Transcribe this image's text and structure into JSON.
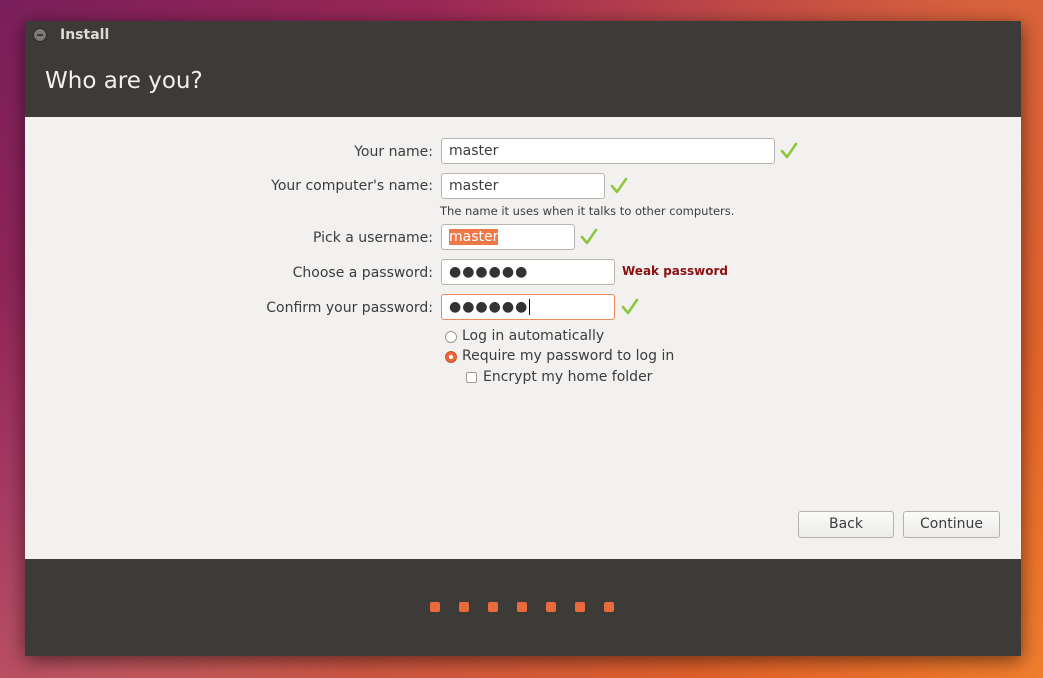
{
  "window": {
    "title": "Install",
    "heading": "Who are you?"
  },
  "form": {
    "name_label": "Your name:",
    "name_value": "master",
    "computer_label": "Your computer's name:",
    "computer_value": "master",
    "computer_hint": "The name it uses when it talks to other computers.",
    "username_label": "Pick a username:",
    "username_value": "master",
    "password_label": "Choose a password:",
    "password_value": "●●●●●●",
    "password_strength": "Weak password",
    "confirm_label": "Confirm your password:",
    "confirm_value": "●●●●●●",
    "login_auto_label": "Log in automatically",
    "require_password_label": "Require my password to log in",
    "encrypt_label": "Encrypt my home folder",
    "selected_login_option": "Require my password to log in",
    "encrypt_checked": false
  },
  "buttons": {
    "back": "Back",
    "continue": "Continue"
  },
  "progress": {
    "steps_total": 7,
    "color": "#e96a3a"
  },
  "icons": {
    "valid": "check-icon",
    "close": "close-icon"
  },
  "colors": {
    "accent": "#e96a3a",
    "titlebar": "#3c3b37",
    "weak_password": "#8b1010",
    "valid_check": "#8dc63f"
  }
}
